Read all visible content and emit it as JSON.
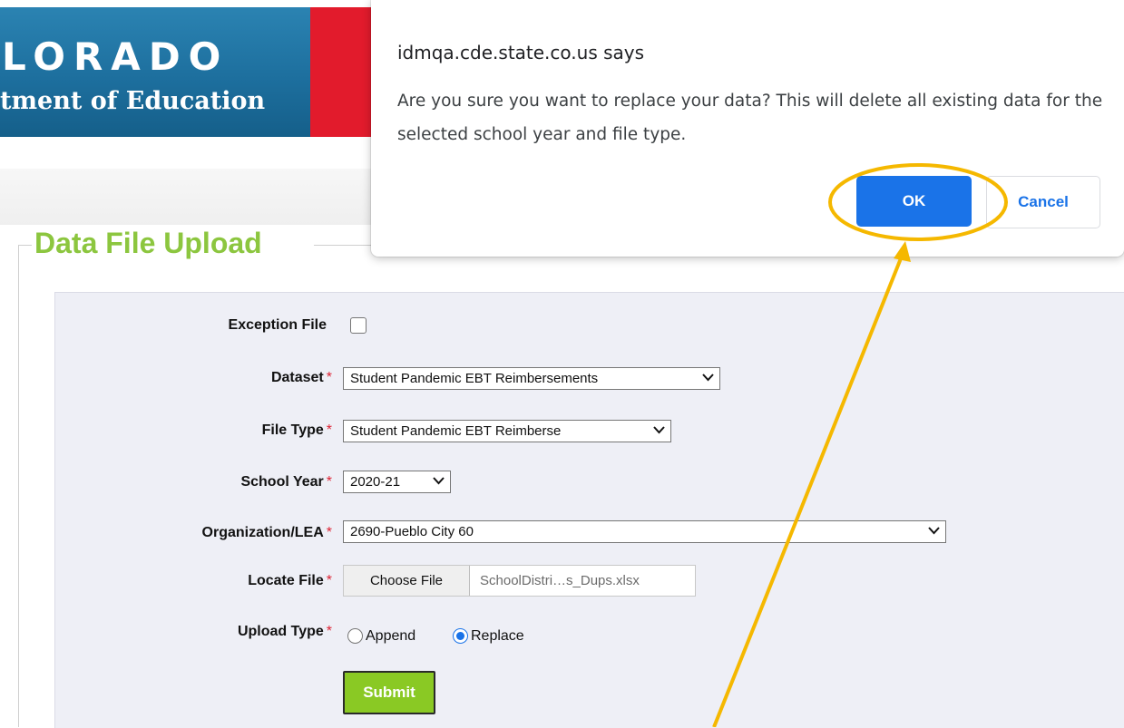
{
  "header": {
    "brand": "LORADO",
    "subtitle": "tment of Education"
  },
  "dialog": {
    "title": "idmqa.cde.state.co.us says",
    "message": "Are you sure you want to replace your data? This will delete all existing data for the selected school year and file type.",
    "ok_label": "OK",
    "cancel_label": "Cancel"
  },
  "form": {
    "legend": "Data File Upload",
    "required_mark": "*",
    "exception_label": "Exception File",
    "exception_checked": false,
    "dataset_label": "Dataset",
    "dataset_value": "Student Pandemic EBT Reimbersements",
    "filetype_label": "File Type",
    "filetype_value": "Student Pandemic EBT Reimberse",
    "schoolyear_label": "School Year",
    "schoolyear_value": "2020-21",
    "org_label": "Organization/LEA",
    "org_value": "2690-Pueblo City 60",
    "locate_label": "Locate File",
    "choose_file_label": "Choose File",
    "file_name": "SchoolDistri…s_Dups.xlsx",
    "uploadtype_label": "Upload Type",
    "append_label": "Append",
    "replace_label": "Replace",
    "upload_type_selected": "Replace",
    "submit_label": "Submit"
  },
  "icons": {
    "dropdown": "chevron-down-icon"
  },
  "colors": {
    "banner_blue": "#1d6f9e",
    "banner_red": "#e21b2c",
    "legend_green": "#8cc63f",
    "submit_green": "#8ac924",
    "dialog_blue": "#1a73e8",
    "annotation_gold": "#f5b800"
  }
}
